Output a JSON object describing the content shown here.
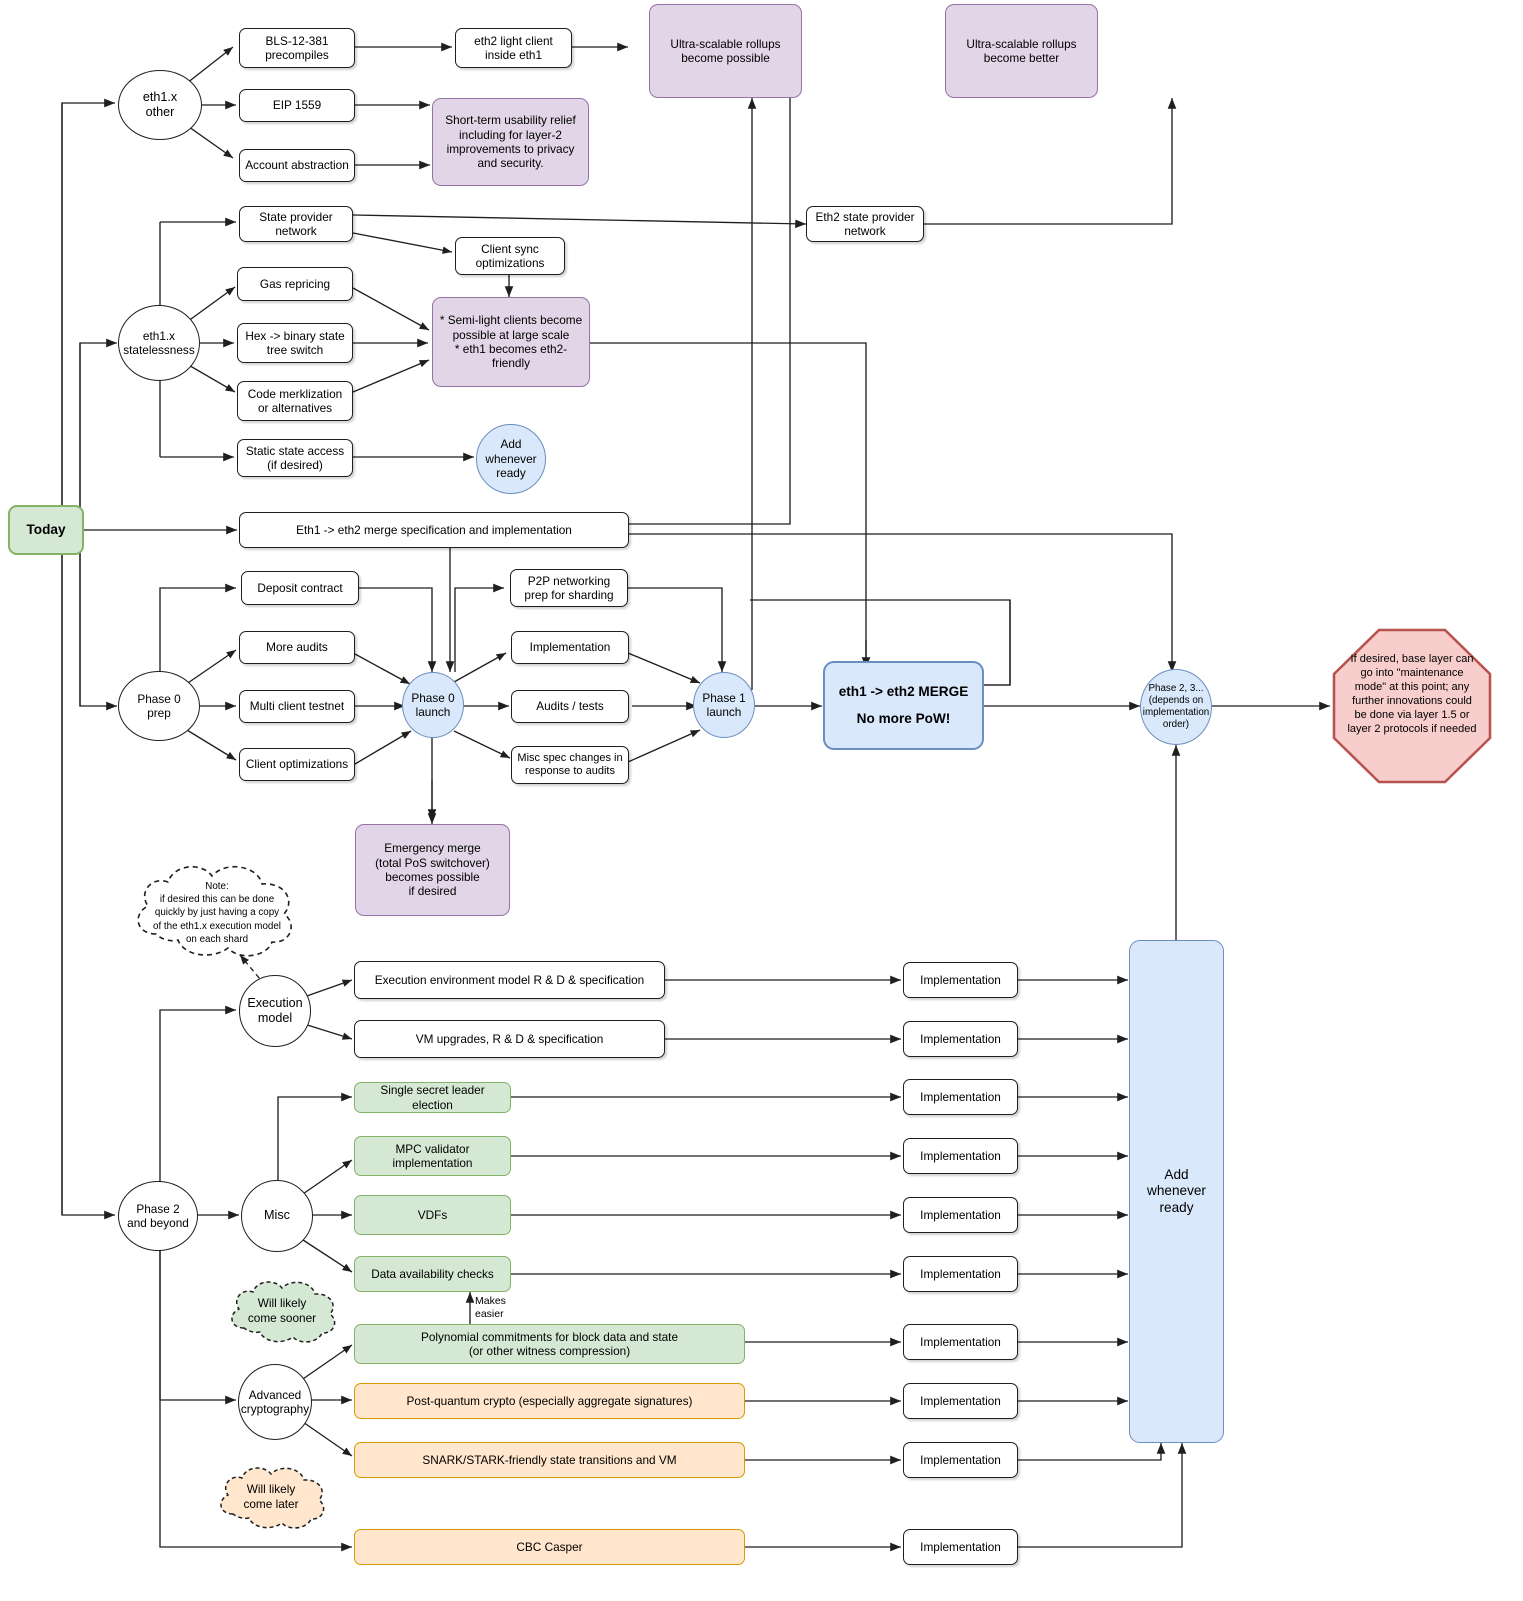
{
  "diagram": {
    "title": "Ethereum eth1 to eth2 roadmap flowchart",
    "colors": {
      "purple_fill": "#e1d5e7",
      "purple_stroke": "#9673a6",
      "green_fill": "#d5e8d4",
      "green_stroke": "#82b366",
      "orange_fill": "#ffe6cc",
      "orange_stroke": "#d79b00",
      "blue_fill": "#dae8fc",
      "blue_stroke": "#6c8ebf",
      "red_fill": "#f8cecc",
      "red_stroke": "#b85450",
      "white_fill": "#ffffff",
      "stroke": "#1f1f1f"
    }
  },
  "nodes": {
    "today": "Today",
    "eth1x_other": "eth1.x\nother",
    "bls_precompiles": "BLS-12-381\nprecompiles",
    "eip1559": "EIP 1559",
    "account_abstraction": "Account abstraction",
    "eth2_light_client": "eth2 light client\ninside eth1",
    "ultra_rollups_possible": "Ultra-scalable rollups\nbecome possible",
    "ultra_rollups_better": "Ultra-scalable rollups\nbecome better",
    "short_term_relief": "Short-term usability relief including for layer-2 improvements to privacy and security.",
    "eth1x_statelessness": "eth1.x\nstatelessness",
    "state_provider_network": "State provider\nnetwork",
    "gas_repricing": "Gas repricing",
    "hex_binary": "Hex -> binary state\ntree switch",
    "code_merklization": "Code merklization\nor alternatives",
    "static_state_access": "Static state access\n(if desired)",
    "client_sync_opt": "Client sync\noptimizations",
    "semi_light_clients": "* Semi-light clients become possible at large scale\n* eth1 becomes eth2-friendly",
    "eth2_state_provider": "Eth2 state provider\nnetwork",
    "add_whenever_ready_top": "Add\nwhenever\nready",
    "merge_spec": "Eth1 -> eth2 merge specification and implementation",
    "phase0_prep": "Phase 0\nprep",
    "deposit_contract": "Deposit contract",
    "more_audits": "More audits",
    "multi_client_testnet": "Multi client testnet",
    "client_optimizations": "Client optimizations",
    "phase0_launch": "Phase 0\nlaunch",
    "p2p_networking": "P2P networking\nprep for sharding",
    "implementation_p1": "Implementation",
    "audits_tests": "Audits / tests",
    "misc_spec_changes": "Misc spec changes in\nresponse to audits",
    "phase1_launch": "Phase 1\nlaunch",
    "merge_line1": "eth1 -> eth2 MERGE",
    "merge_line2": "No more PoW!",
    "phase23": "Phase 2, 3...\n(depends on\nimplementation\norder)",
    "maintenance_mode": "If desired, base layer can go into \"maintenance mode\" at this point; any further innovations could be done via layer 1.5 or layer 2 protocols if needed",
    "emergency_merge": "Emergency merge\n(total PoS switchover)\nbecomes possible\nif desired",
    "note_cloud": "Note:\nif desired this can be done\nquickly by just having a copy\nof the eth1.x execution model\non each shard",
    "execution_model": "Execution\nmodel",
    "exec_env_rd": "Execution environment model R & D & specification",
    "vm_upgrades": "VM upgrades, R & D & specification",
    "phase2_beyond": "Phase 2\nand beyond",
    "misc": "Misc",
    "single_secret_leader": "Single secret leader election",
    "mpc_validator": "MPC validator\nimplementation",
    "vdfs": "VDFs",
    "data_availability": "Data availability checks",
    "will_come_sooner": "Will likely\ncome sooner",
    "polynomial_commitments": "Polynomial commitments for block data and state\n(or other witness compression)",
    "advanced_crypto": "Advanced\ncryptography",
    "post_quantum": "Post-quantum crypto (especially aggregate signatures)",
    "snark_stark": "SNARK/STARK-friendly state transitions and VM",
    "will_come_later": "Will likely\ncome later",
    "cbc_casper": "CBC Casper",
    "add_whenever_ready_bar": "Add\nwhenever\nready"
  },
  "edge_labels": {
    "makes_easier": "Makes\neasier"
  },
  "implementation_boxes": [
    "Implementation",
    "Implementation",
    "Implementation",
    "Implementation",
    "Implementation",
    "Implementation",
    "Implementation",
    "Implementation",
    "Implementation",
    "Implementation"
  ]
}
